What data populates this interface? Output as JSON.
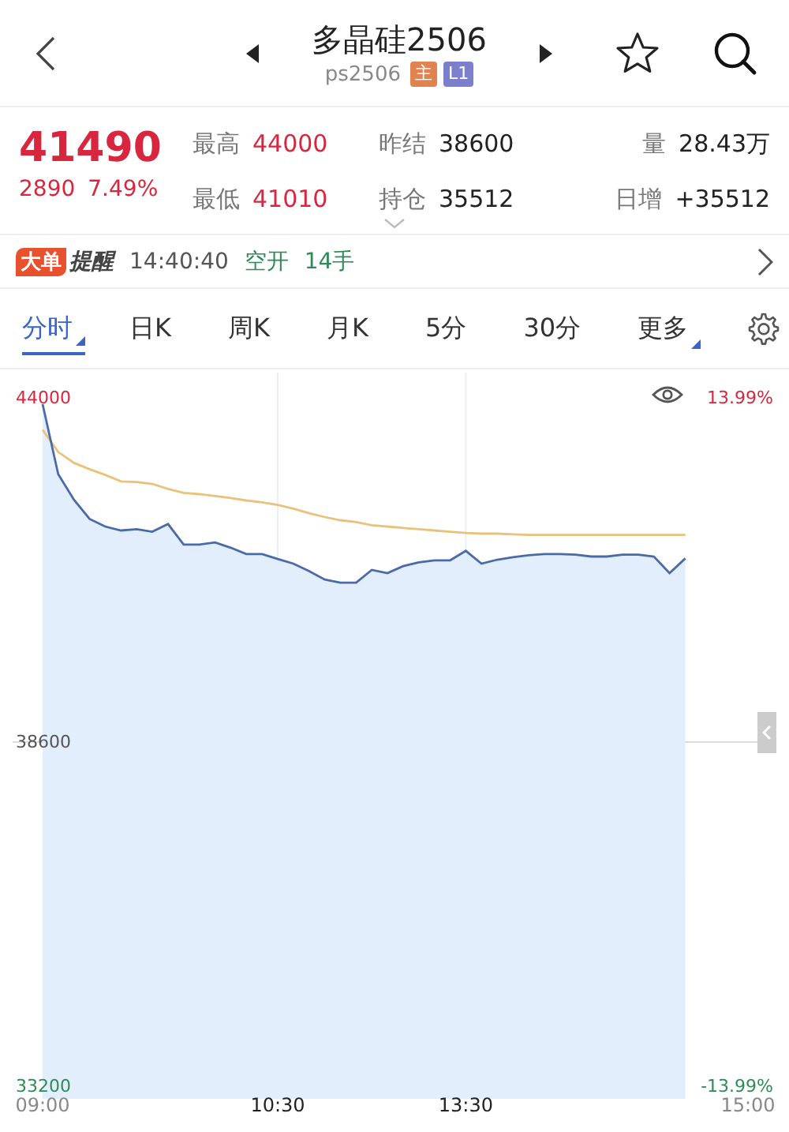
{
  "header": {
    "title": "多晶硅2506",
    "code": "ps2506",
    "badges": [
      {
        "text": "主",
        "color": "#e0834f"
      },
      {
        "text": "L1",
        "color": "#7c80cc"
      }
    ]
  },
  "quote": {
    "price": "41490",
    "change": "2890",
    "change_pct": "7.49%",
    "stats": [
      {
        "label": "最高",
        "value": "44000",
        "color": "#d7263d"
      },
      {
        "label": "昨结",
        "value": "38600",
        "color": "#222222"
      },
      {
        "label": "量",
        "value": "28.43万",
        "color": "#222222"
      },
      {
        "label": "最低",
        "value": "41010",
        "color": "#d7263d"
      },
      {
        "label": "持仓",
        "value": "35512",
        "color": "#222222"
      },
      {
        "label": "日增",
        "value": "+35512",
        "color": "#222222"
      }
    ]
  },
  "alert": {
    "tag": "大单",
    "title": "提醒",
    "time": "14:40:40",
    "action": "空开",
    "volume": "14手"
  },
  "tabs": [
    {
      "label": "分时",
      "selected": true,
      "menu": true
    },
    {
      "label": "日K",
      "selected": false,
      "menu": false
    },
    {
      "label": "周K",
      "selected": false,
      "menu": false
    },
    {
      "label": "月K",
      "selected": false,
      "menu": false
    },
    {
      "label": "5分",
      "selected": false,
      "menu": false
    },
    {
      "label": "30分",
      "selected": false,
      "menu": false
    },
    {
      "label": "更多",
      "selected": false,
      "menu": true
    }
  ],
  "chart": {
    "right_labels": [
      {
        "text": "13.99%",
        "color": "#d7263d"
      },
      {
        "text": "-13.99%",
        "color": "#2e8b57"
      }
    ],
    "chart_data": {
      "type": "area",
      "categories": [
        "09:00",
        null,
        null,
        null,
        null,
        null,
        null,
        null,
        null,
        null,
        null,
        null,
        null,
        null,
        null,
        "10:30",
        null,
        null,
        null,
        null,
        null,
        null,
        null,
        null,
        null,
        null,
        null,
        "13:30",
        null,
        null,
        null,
        null,
        null,
        null,
        null,
        null,
        null,
        null,
        null,
        null,
        null,
        null,
        null,
        null,
        null,
        "15:00"
      ],
      "series": [
        {
          "color": "#4a6aa8",
          "type": "area",
          "values": [
            43900,
            42800,
            42400,
            42100,
            41980,
            41920,
            41940,
            41900,
            42020,
            41700,
            41700,
            41730,
            41650,
            41550,
            41550,
            41470,
            41400,
            41280,
            41150,
            41100,
            41100,
            41300,
            41250,
            41360,
            41420,
            41450,
            41450,
            41600,
            41400,
            41460,
            41500,
            41530,
            41550,
            41550,
            41540,
            41510,
            41510,
            41540,
            41540,
            41510,
            41250,
            41480,
            null,
            null,
            null,
            null
          ]
        },
        {
          "color": "#e8c27a",
          "type": "line",
          "values": [
            43500,
            43150,
            42980,
            42880,
            42790,
            42690,
            42680,
            42650,
            42570,
            42510,
            42490,
            42460,
            42430,
            42390,
            42360,
            42320,
            42260,
            42190,
            42130,
            42080,
            42050,
            42000,
            41980,
            41960,
            41940,
            41920,
            41900,
            41880,
            41870,
            41870,
            41860,
            41850,
            41850,
            41850,
            41850,
            41850,
            41850,
            41850,
            41850,
            41850,
            41850,
            41850,
            null,
            null,
            null,
            null
          ]
        }
      ],
      "ylim": [
        33200,
        44000
      ],
      "yticks": [
        44000,
        38600,
        33200
      ],
      "ref_lines": [
        {
          "axis": "y",
          "value": 38600
        }
      ]
    }
  }
}
